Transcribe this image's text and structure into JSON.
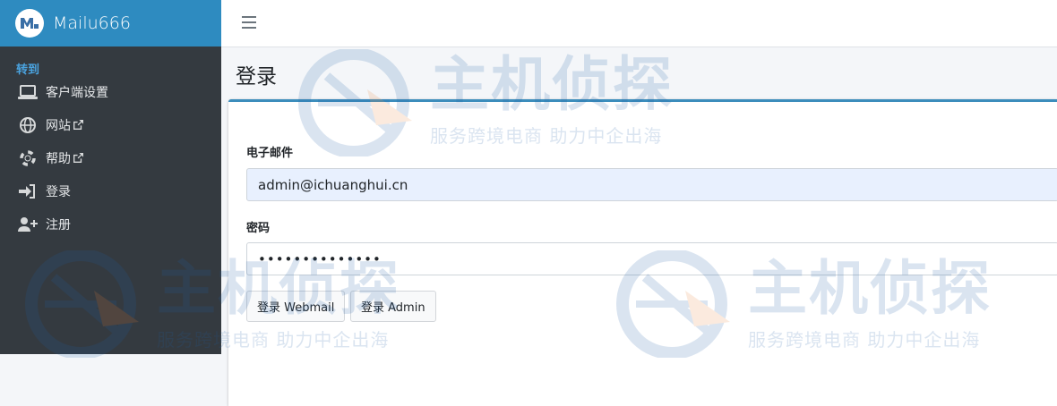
{
  "brand": {
    "name": "Mailu666"
  },
  "sidebar": {
    "header": "转到",
    "items": [
      {
        "label": "客户端设置",
        "icon": "laptop-icon"
      },
      {
        "label": "网站",
        "icon": "globe-icon"
      },
      {
        "label": "帮助",
        "icon": "lifebuoy-icon"
      },
      {
        "label": "登录",
        "icon": "sign-in-icon"
      },
      {
        "label": "注册",
        "icon": "user-plus-icon"
      }
    ]
  },
  "page": {
    "title": "登录"
  },
  "form": {
    "email_label": "电子邮件",
    "email_value": "admin@ichuanghui.cn",
    "password_label": "密码",
    "password_value": "••••••••••••••",
    "webmail_button": "登录 Webmail",
    "admin_button": "登录 Admin"
  },
  "watermark": {
    "title": "主机侦探",
    "slogan": "服务跨境电商 助力中企出海"
  },
  "colors": {
    "sidebar": "#343a40",
    "brand": "#2e8bc0",
    "accent": "#3c8dbc",
    "header_text": "#4aa3df"
  }
}
